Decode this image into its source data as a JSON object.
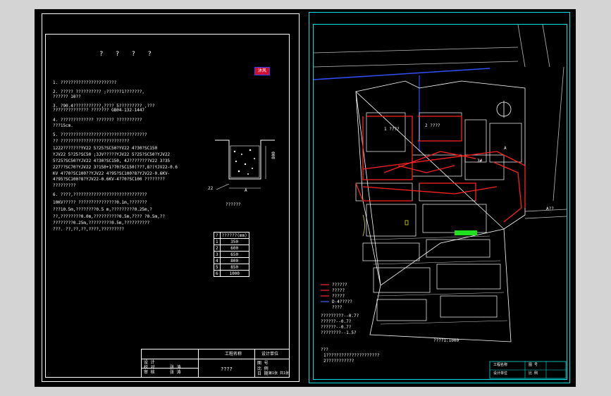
{
  "left_sheet": {
    "title": "? ? ? ?",
    "logo_text": "沐风",
    "notes": [
      "1. ??????????????????????",
      "2. ?????    ??????????  ;??????1???????,",
      "     ??????    10??",
      "3. ?90.4???????????,????  5?????????  ,???",
      "     ??????????????         ???????    GB04-132-1447",
      "4. ?????????????          ???????    ??????????",
      "     ???15cm.",
      "5. ??????????????????????????????????",
      "     ?? ???????????????????????????",
      "     1222???????YV22  5?25?SC50?YV22  4?30?SC150",
      "     YJV22  5?25?SC50 ;3JV?????YJV22  5?25?SC50?YJV22",
      "     5?25?SC50?YJV22  4?30?SC150,   4J????????V22  3?35",
      "     227??SC70?YJV22  3?150+1?70?SC150(???,8?)YJV22-0.6",
      "     KV  4?70?SC100??YJV22  4?95?SC100?8?YJV22-0.6KV-",
      "     4?95?SC100?8?YJV22-0.6KV-4?70?SC100  ????????",
      "     ?????????",
      "6. ????,?????????????????????????????",
      "     10KV?????     ???????????????0.1m,???????",
      "     ???10.5m,????????0.5            m,?????????0.25m,?",
      "     ??,????????0.0m,??????????0.5m,????               ?0.5m,??",
      "     ????????0.25m,?????????0.5m,??????????",
      "     ???.  ??,??,??,????,?????????"
    ],
    "trench_section_label": "??????",
    "trench_dims": {
      "depth": "800",
      "top": "22",
      "side": "A"
    },
    "pipe_table": {
      "header": [
        "?",
        "??????(mm)"
      ],
      "rows": [
        [
          "1",
          "350"
        ],
        [
          "2",
          "600"
        ],
        [
          "3",
          "650"
        ],
        [
          "4",
          "800"
        ],
        [
          "5",
          "850"
        ],
        [
          "6",
          "1000"
        ]
      ]
    },
    "title_block": {
      "project_label": "工程名称",
      "drawing_label": "设计单位",
      "drawing_title": "????",
      "rows": [
        "设 计",
        "校 对",
        "审 核",
        "审 定"
      ],
      "signs": [
        "张 涛",
        "张 涛"
      ],
      "right": [
        "图 号",
        "比 例",
        "日 期"
      ],
      "sheet_no": "第1张 共1张"
    }
  },
  "right_sheet": {
    "north_arrow_label": "N",
    "scale_note": "????1:1000",
    "entry_label": "A??",
    "building_labels": [
      "1 ????",
      "2 ????",
      "3#",
      "A"
    ],
    "legend": [
      {
        "color": "#ff3030",
        "text": "??????"
      },
      {
        "color": "#ff3030",
        "text": "?????"
      },
      {
        "color": "#ff3030",
        "text": "?????"
      },
      {
        "color": "#4060ff",
        "text": "D-4?????"
      },
      {
        "color": "#ffffff",
        "text": "????"
      }
    ],
    "levels": [
      "?????????--0.7?",
      "??????--0.7?",
      "??????--0.7?",
      "????????--1.5?"
    ],
    "notes_title": "???",
    "notes": [
      "1?????????????????????",
      "2???????????"
    ],
    "title_block_text": [
      "工程名称",
      "设计单位",
      "图 号",
      "比 例"
    ]
  },
  "colors": {
    "background": "#000000",
    "frame_right": "#00e0e0",
    "power_cable": "#ff2020",
    "water_line": "#3050ff",
    "green_block": "#20e020"
  }
}
